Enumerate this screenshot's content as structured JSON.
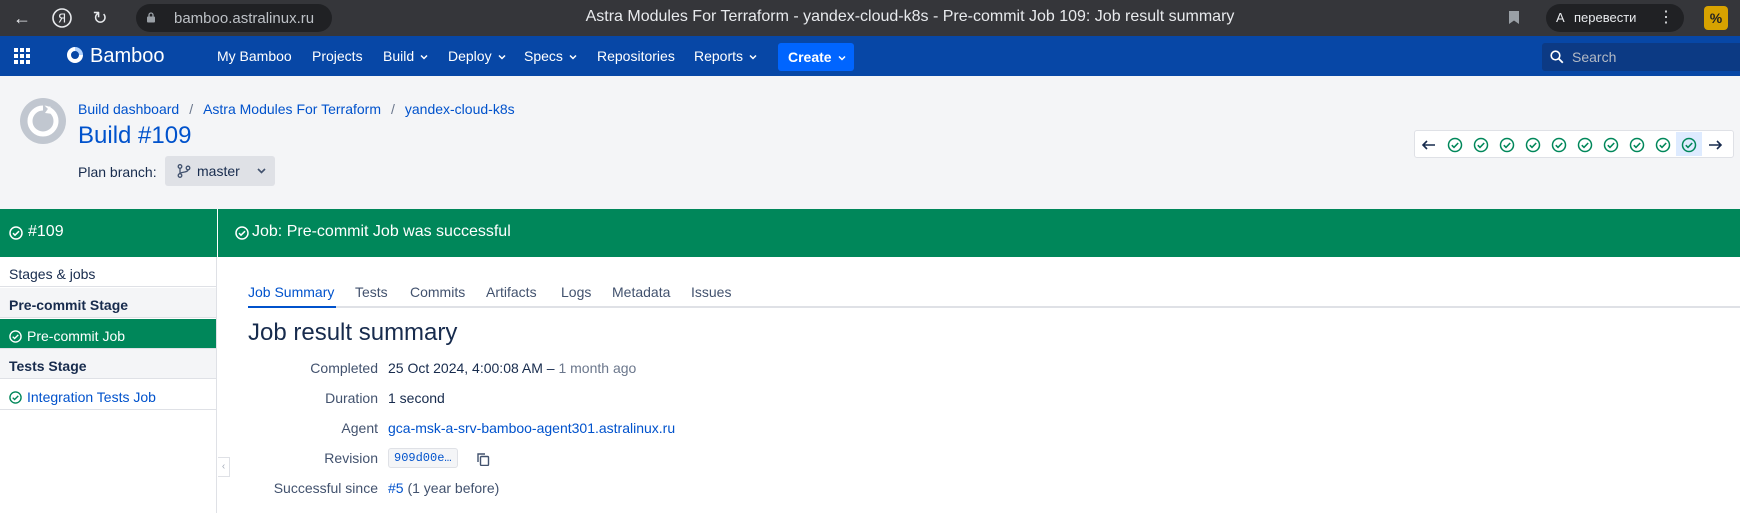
{
  "browser": {
    "url": "bamboo.astralinux.ru",
    "tab_title": "Astra Modules For Terraform - yandex-cloud-k8s - Pre-commit Job 109: Job result summary",
    "translate_label": "перевести",
    "ext_label": "%"
  },
  "header": {
    "logo": "Bamboo",
    "nav": [
      {
        "label": "My Bamboo"
      },
      {
        "label": "Projects"
      },
      {
        "label": "Build"
      },
      {
        "label": "Deploy"
      },
      {
        "label": "Specs"
      },
      {
        "label": "Repositories"
      },
      {
        "label": "Reports"
      }
    ],
    "create_label": "Create",
    "search_placeholder": "Search"
  },
  "breadcrumb": [
    "Build dashboard",
    "Astra Modules For Terraform",
    "yandex-cloud-k8s"
  ],
  "build_title": "Build #109",
  "plan_branch_label": "Plan branch:",
  "branch": "master",
  "history_icons": [
    "arrow-left",
    "success",
    "success",
    "success",
    "success",
    "success",
    "success",
    "success",
    "success",
    "success",
    "success-current",
    "arrow-right"
  ],
  "banner": {
    "side_text": "#109",
    "main_text": "Job: Pre-commit Job was successful"
  },
  "sidebar": {
    "stages_jobs": "Stages & jobs",
    "stage1": "Pre-commit Stage",
    "job1": "Pre-commit Job",
    "stage2": "Tests Stage",
    "job2": "Integration Tests Job"
  },
  "tabs": [
    "Job Summary",
    "Tests",
    "Commits",
    "Artifacts",
    "Logs",
    "Metadata",
    "Issues"
  ],
  "job_title": "Job result summary",
  "summary": {
    "completed_label": "Completed",
    "completed_value": "25 Oct 2024, 4:00:08 AM",
    "completed_sep": " – ",
    "completed_ago": "1 month ago",
    "duration_label": "Duration",
    "duration_value": "1 second",
    "agent_label": "Agent",
    "agent_value": "gca-msk-a-srv-bamboo-agent301.astralinux.ru",
    "revision_label": "Revision",
    "revision_value": "909d00e…",
    "since_label": "Successful since",
    "since_link": "#5",
    "since_note": " (1 year before)"
  },
  "colors": {
    "header": "#0747a6",
    "success": "#00875a",
    "link": "#0052cc"
  }
}
